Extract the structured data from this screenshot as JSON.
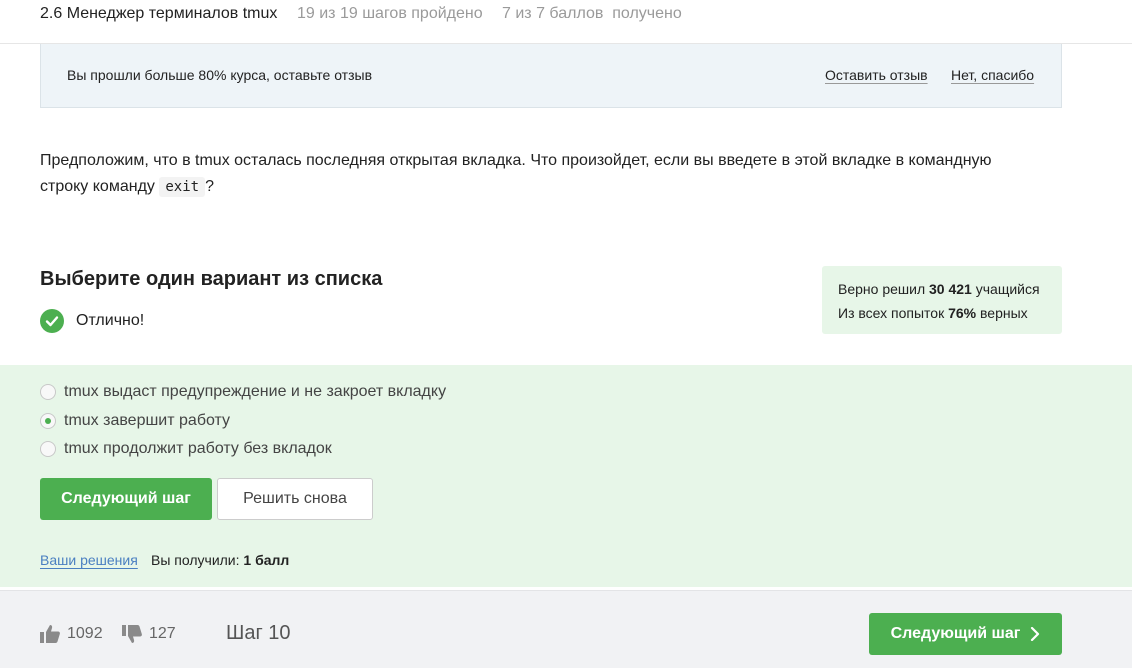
{
  "header": {
    "title": "2.6 Менеджер терминалов tmux",
    "steps_done": "19 из 19 шагов пройдено",
    "points": "7 из 7 баллов  получено"
  },
  "feedback": {
    "message": "Вы прошли больше 80% курса, оставьте отзыв",
    "leave_review": "Оставить отзыв",
    "no_thanks": "Нет, спасибо"
  },
  "question": {
    "text_before": "Предположим, что в tmux осталась последняя открытая вкладка. Что произойдет, если вы введете в этой вкладке в командную строку команду ",
    "code": "exit",
    "text_after": "?"
  },
  "quiz": {
    "heading": "Выберите один вариант из списка",
    "status": "Отлично!"
  },
  "stats": {
    "solved_prefix": "Верно решил",
    "solved_count": "30 421",
    "solved_suffix": "учащийся",
    "attempts_prefix": "Из всех попыток",
    "attempts_percent": "76%",
    "attempts_suffix": "верных"
  },
  "options": [
    {
      "label": "tmux выдаст предупреждение и не закроет вкладку",
      "selected": false
    },
    {
      "label": "tmux завершит работу",
      "selected": true
    },
    {
      "label": "tmux продолжит работу без вкладок",
      "selected": false
    }
  ],
  "actions": {
    "next_step": "Следующий шаг",
    "retry": "Решить снова",
    "your_solutions": "Ваши решения",
    "score_label": "Вы получили:",
    "score_value": "1 балл"
  },
  "footer": {
    "likes": "1092",
    "dislikes": "127",
    "step_label": "Шаг 10",
    "next_step": "Следующий шаг"
  },
  "colors": {
    "accent": "#4caf50",
    "success_bg": "#e7f6e8",
    "notice_bg": "#eef4f8",
    "link": "#4a7fc1"
  },
  "icons": [
    "check-circle-icon",
    "thumbs-up-icon",
    "thumbs-down-icon",
    "chevron-right-icon"
  ]
}
